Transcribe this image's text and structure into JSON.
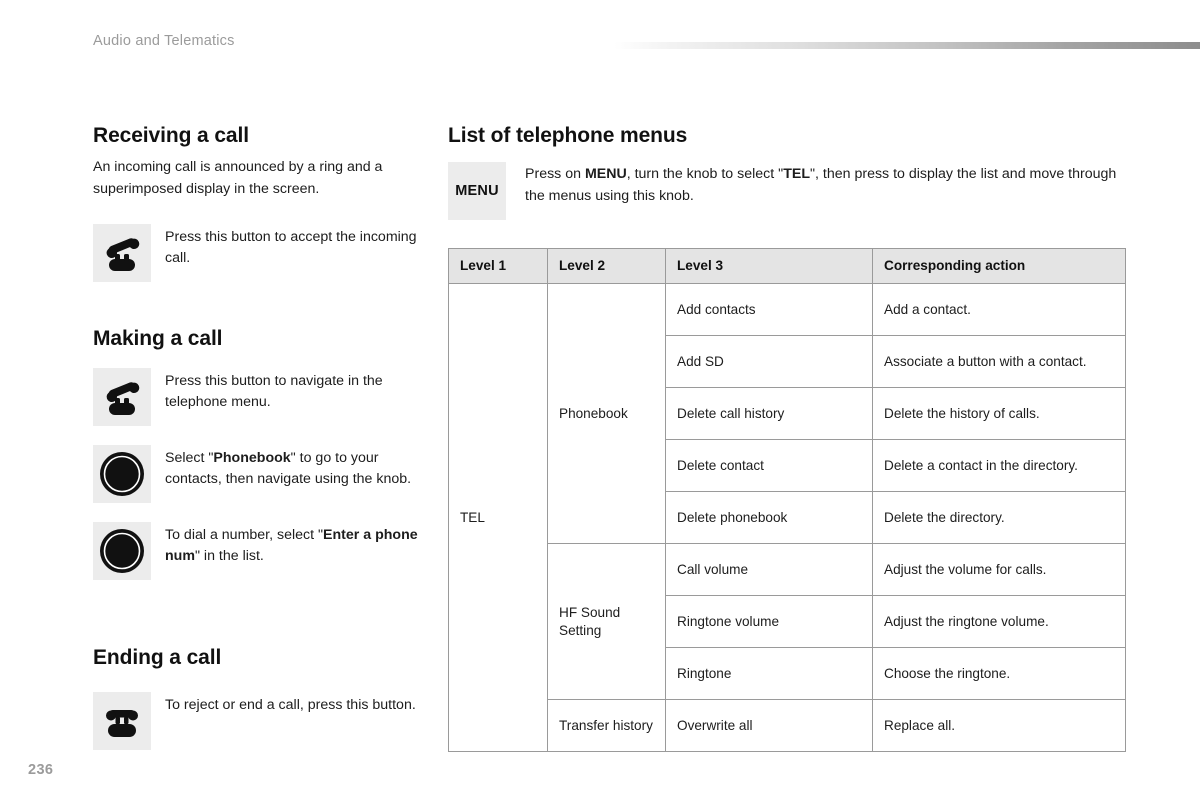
{
  "running_header": "Audio and Telematics",
  "page_number": "236",
  "left_column": {
    "receiving": {
      "heading": "Receiving a call",
      "body": "An incoming call is announced by a ring and a superimposed display in the screen.",
      "row": {
        "icon": "phone-pickup-icon",
        "text": "Press this button to accept the incoming call."
      }
    },
    "making": {
      "heading": "Making a call",
      "rows": [
        {
          "icon": "phone-pickup-icon",
          "text": "Press this button to navigate in the telephone menu."
        },
        {
          "icon": "rotary-knob-icon",
          "text_before": "Select \"",
          "text_bold": "Phonebook",
          "text_after": "\" to go to your contacts, then navigate using the knob."
        },
        {
          "icon": "rotary-knob-icon",
          "text_before": "To dial a number, select \"",
          "text_bold": "Enter a phone num",
          "text_after": "\" in the list."
        }
      ]
    },
    "ending": {
      "heading": "Ending a call",
      "row": {
        "icon": "phone-hangup-icon",
        "text": "To reject or end a call, press this button."
      }
    }
  },
  "right_column": {
    "heading": "List of telephone menus",
    "menu_badge": "MENU",
    "menu_note": {
      "part1": "Press on ",
      "bold1": "MENU",
      "part2": ", turn the knob to select \"",
      "bold2": "TEL",
      "part3": "\", then press to display the list and move through the menus using this knob."
    },
    "table": {
      "headers": [
        "Level 1",
        "Level 2",
        "Level 3",
        "Corresponding action"
      ],
      "level1": "TEL",
      "groups": [
        {
          "level2": "Phonebook",
          "rows": [
            {
              "level3": "Add contacts",
              "action": "Add a contact."
            },
            {
              "level3": "Add SD",
              "action": "Associate a button with a contact."
            },
            {
              "level3": "Delete call history",
              "action": "Delete the history of calls."
            },
            {
              "level3": "Delete contact",
              "action": "Delete a contact in the directory."
            },
            {
              "level3": "Delete phonebook",
              "action": "Delete the directory."
            }
          ]
        },
        {
          "level2": "HF Sound Setting",
          "rows": [
            {
              "level3": "Call volume",
              "action": "Adjust the volume for calls."
            },
            {
              "level3": "Ringtone volume",
              "action": "Adjust the ringtone volume."
            },
            {
              "level3": "Ringtone",
              "action": "Choose the ringtone."
            }
          ]
        },
        {
          "level2": "Transfer history",
          "rows": [
            {
              "level3": "Overwrite all",
              "action": "Replace all."
            }
          ]
        }
      ]
    }
  },
  "colors": {
    "icon_box_bg": "#ececec",
    "table_header_bg": "#e4e4e4",
    "table_border": "#9a9a9a",
    "muted_text": "#9b9b9b",
    "body_text": "#1d1d1d"
  }
}
